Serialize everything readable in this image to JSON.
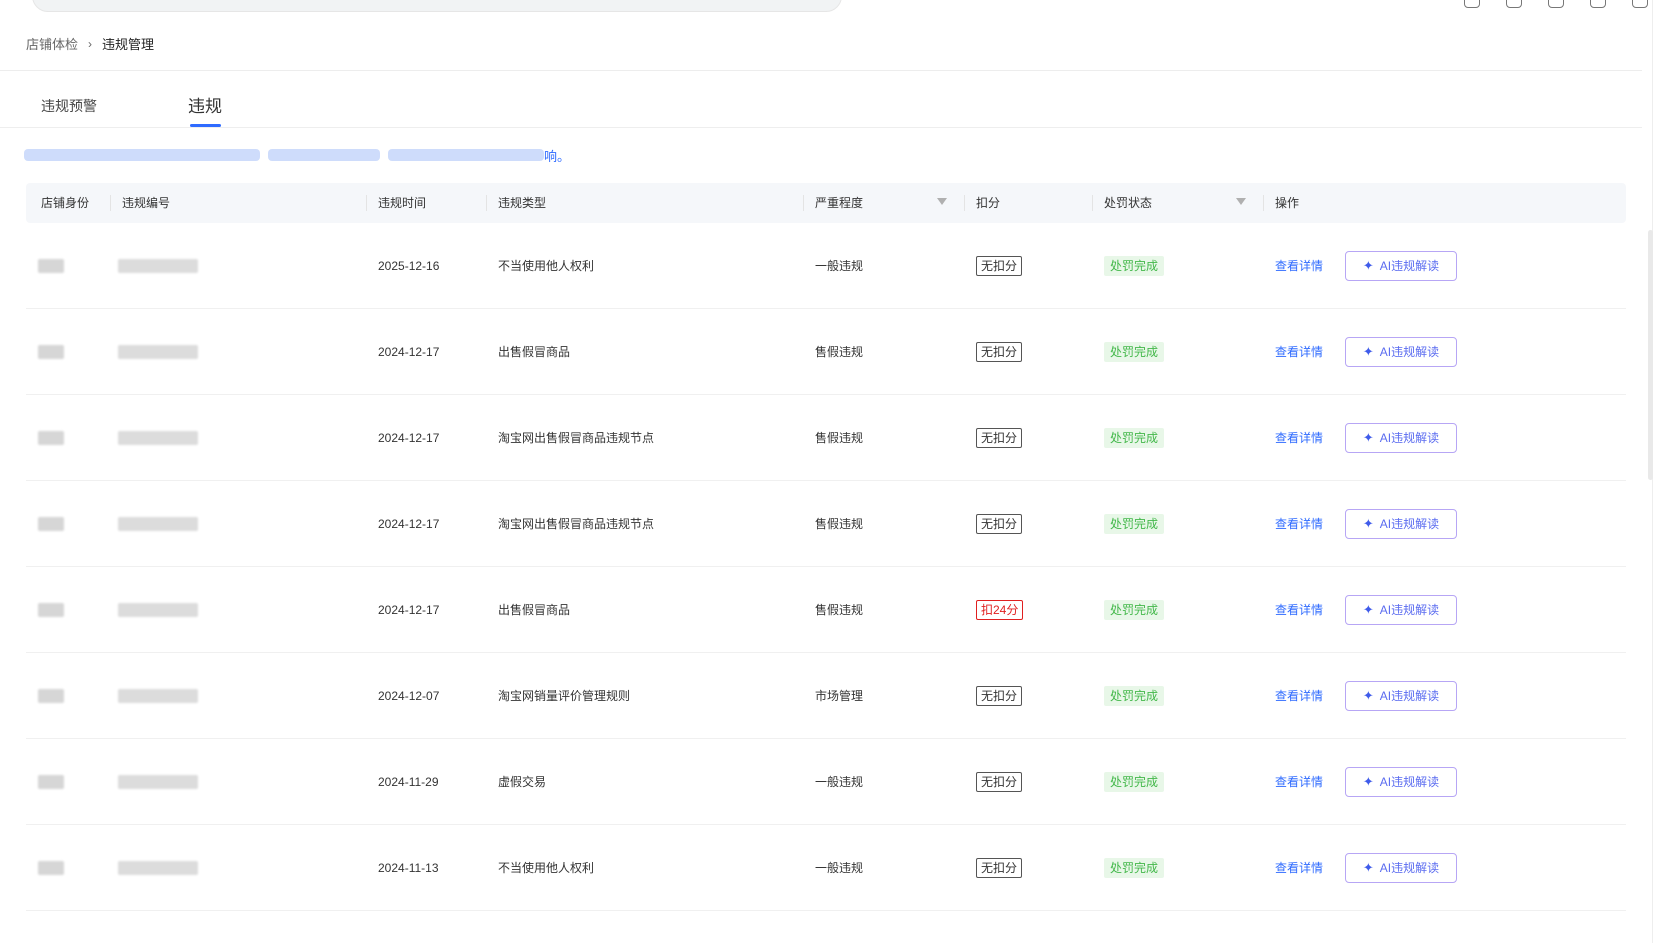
{
  "breadcrumb": {
    "parent": "店铺体检",
    "separator": "›",
    "current": "违规管理"
  },
  "tabs": [
    {
      "label": "违规预警",
      "active": false
    },
    {
      "label": "违规",
      "active": true
    }
  ],
  "notice": {
    "visible_tail": "响。"
  },
  "table": {
    "headers": {
      "shop_identity": "店铺身份",
      "violation_no": "违规编号",
      "violation_time": "违规时间",
      "violation_type": "违规类型",
      "severity": "严重程度",
      "deduction": "扣分",
      "penalty_status": "处罚状态",
      "actions": "操作"
    },
    "action_detail_label": "查看详情",
    "action_ai_label": "AI违规解读",
    "rows": [
      {
        "time": "2025-12-16",
        "type": "不当使用他人权利",
        "severity": "一般违规",
        "deduction": "无扣分",
        "status": "处罚完成"
      },
      {
        "time": "2024-12-17",
        "type": "出售假冒商品",
        "severity": "售假违规",
        "deduction": "无扣分",
        "status": "处罚完成"
      },
      {
        "time": "2024-12-17",
        "type": "淘宝网出售假冒商品违规节点",
        "severity": "售假违规",
        "deduction": "无扣分",
        "status": "处罚完成"
      },
      {
        "time": "2024-12-17",
        "type": "淘宝网出售假冒商品违规节点",
        "severity": "售假违规",
        "deduction": "无扣分",
        "status": "处罚完成"
      },
      {
        "time": "2024-12-17",
        "type": "出售假冒商品",
        "severity": "售假违规",
        "deduction": "扣24分",
        "status": "处罚完成"
      },
      {
        "time": "2024-12-07",
        "type": "淘宝网销量评价管理规则",
        "severity": "市场管理",
        "deduction": "无扣分",
        "status": "处罚完成"
      },
      {
        "time": "2024-11-29",
        "type": "虚假交易",
        "severity": "一般违规",
        "deduction": "无扣分",
        "status": "处罚完成"
      },
      {
        "time": "2024-11-13",
        "type": "不当使用他人权利",
        "severity": "一般违规",
        "deduction": "无扣分",
        "status": "处罚完成"
      }
    ]
  },
  "colors": {
    "accent": "#2f6bff",
    "success_text": "#43b84a",
    "success_bg": "#e8f7e8",
    "danger": "#e02020",
    "ai_border": "#b7a6f5"
  }
}
